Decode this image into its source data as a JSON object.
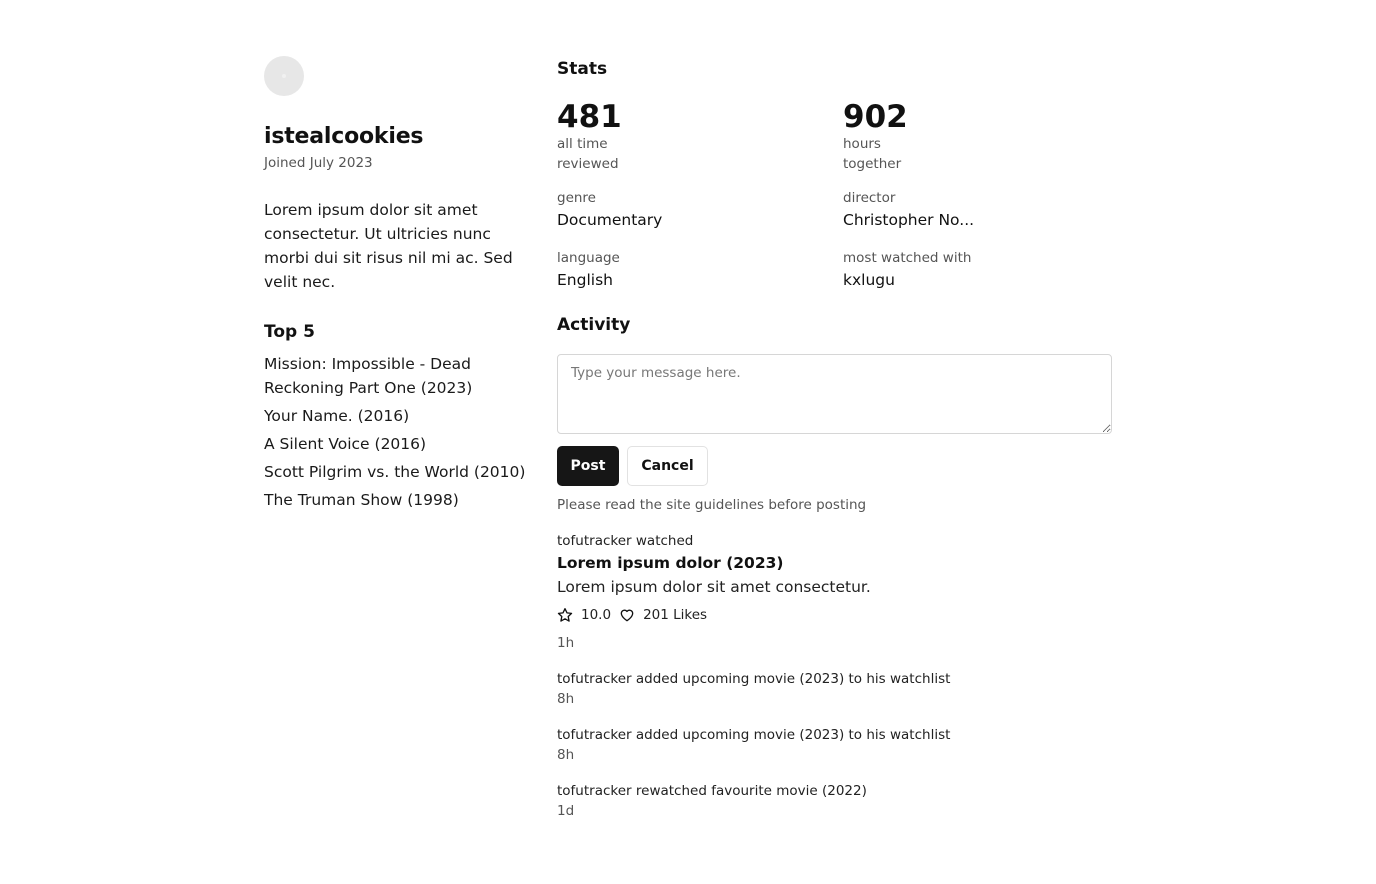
{
  "profile": {
    "username": "istealcookies",
    "joined": "Joined July 2023",
    "bio": "Lorem ipsum dolor sit amet consectetur. Ut ultricies nunc morbi dui sit risus nil mi ac. Sed velit nec.",
    "top_title": "Top 5",
    "top_movies": [
      "Mission: Impossible - Dead Reckoning Part One (2023)",
      "Your Name. (2016)",
      "A Silent Voice (2016)",
      "Scott Pilgrim vs. the World (2010)",
      "The Truman Show (1998)"
    ]
  },
  "stats": {
    "title": "Stats",
    "reviewed": {
      "value": "481",
      "label": "all time reviewed"
    },
    "hours": {
      "value": "902",
      "label": "hours together"
    },
    "genre": {
      "label": "genre",
      "value": "Documentary"
    },
    "director": {
      "label": "director",
      "value": "Christopher No..."
    },
    "language": {
      "label": "language",
      "value": "English"
    },
    "watched_with": {
      "label": "most watched with",
      "value": "kxlugu"
    }
  },
  "activity": {
    "title": "Activity",
    "placeholder": "Type your message here.",
    "post_label": "Post",
    "cancel_label": "Cancel",
    "hint": "Please read the site guidelines before posting",
    "feed": [
      {
        "line": "tofutracker watched",
        "movie": "Lorem ipsum dolor (2023)",
        "review": "Lorem ipsum dolor sit amet consectetur.",
        "rating": "10.0",
        "likes": "201 Likes",
        "time": "1h"
      },
      {
        "line": "tofutracker added upcoming movie (2023) to his watchlist",
        "time": "8h"
      },
      {
        "line": "tofutracker added upcoming movie (2023) to his watchlist",
        "time": "8h"
      },
      {
        "line": "tofutracker rewatched favourite movie (2022)",
        "time": "1d"
      }
    ]
  },
  "icons": {
    "rating": "star-icon",
    "likes": "heart-icon"
  }
}
